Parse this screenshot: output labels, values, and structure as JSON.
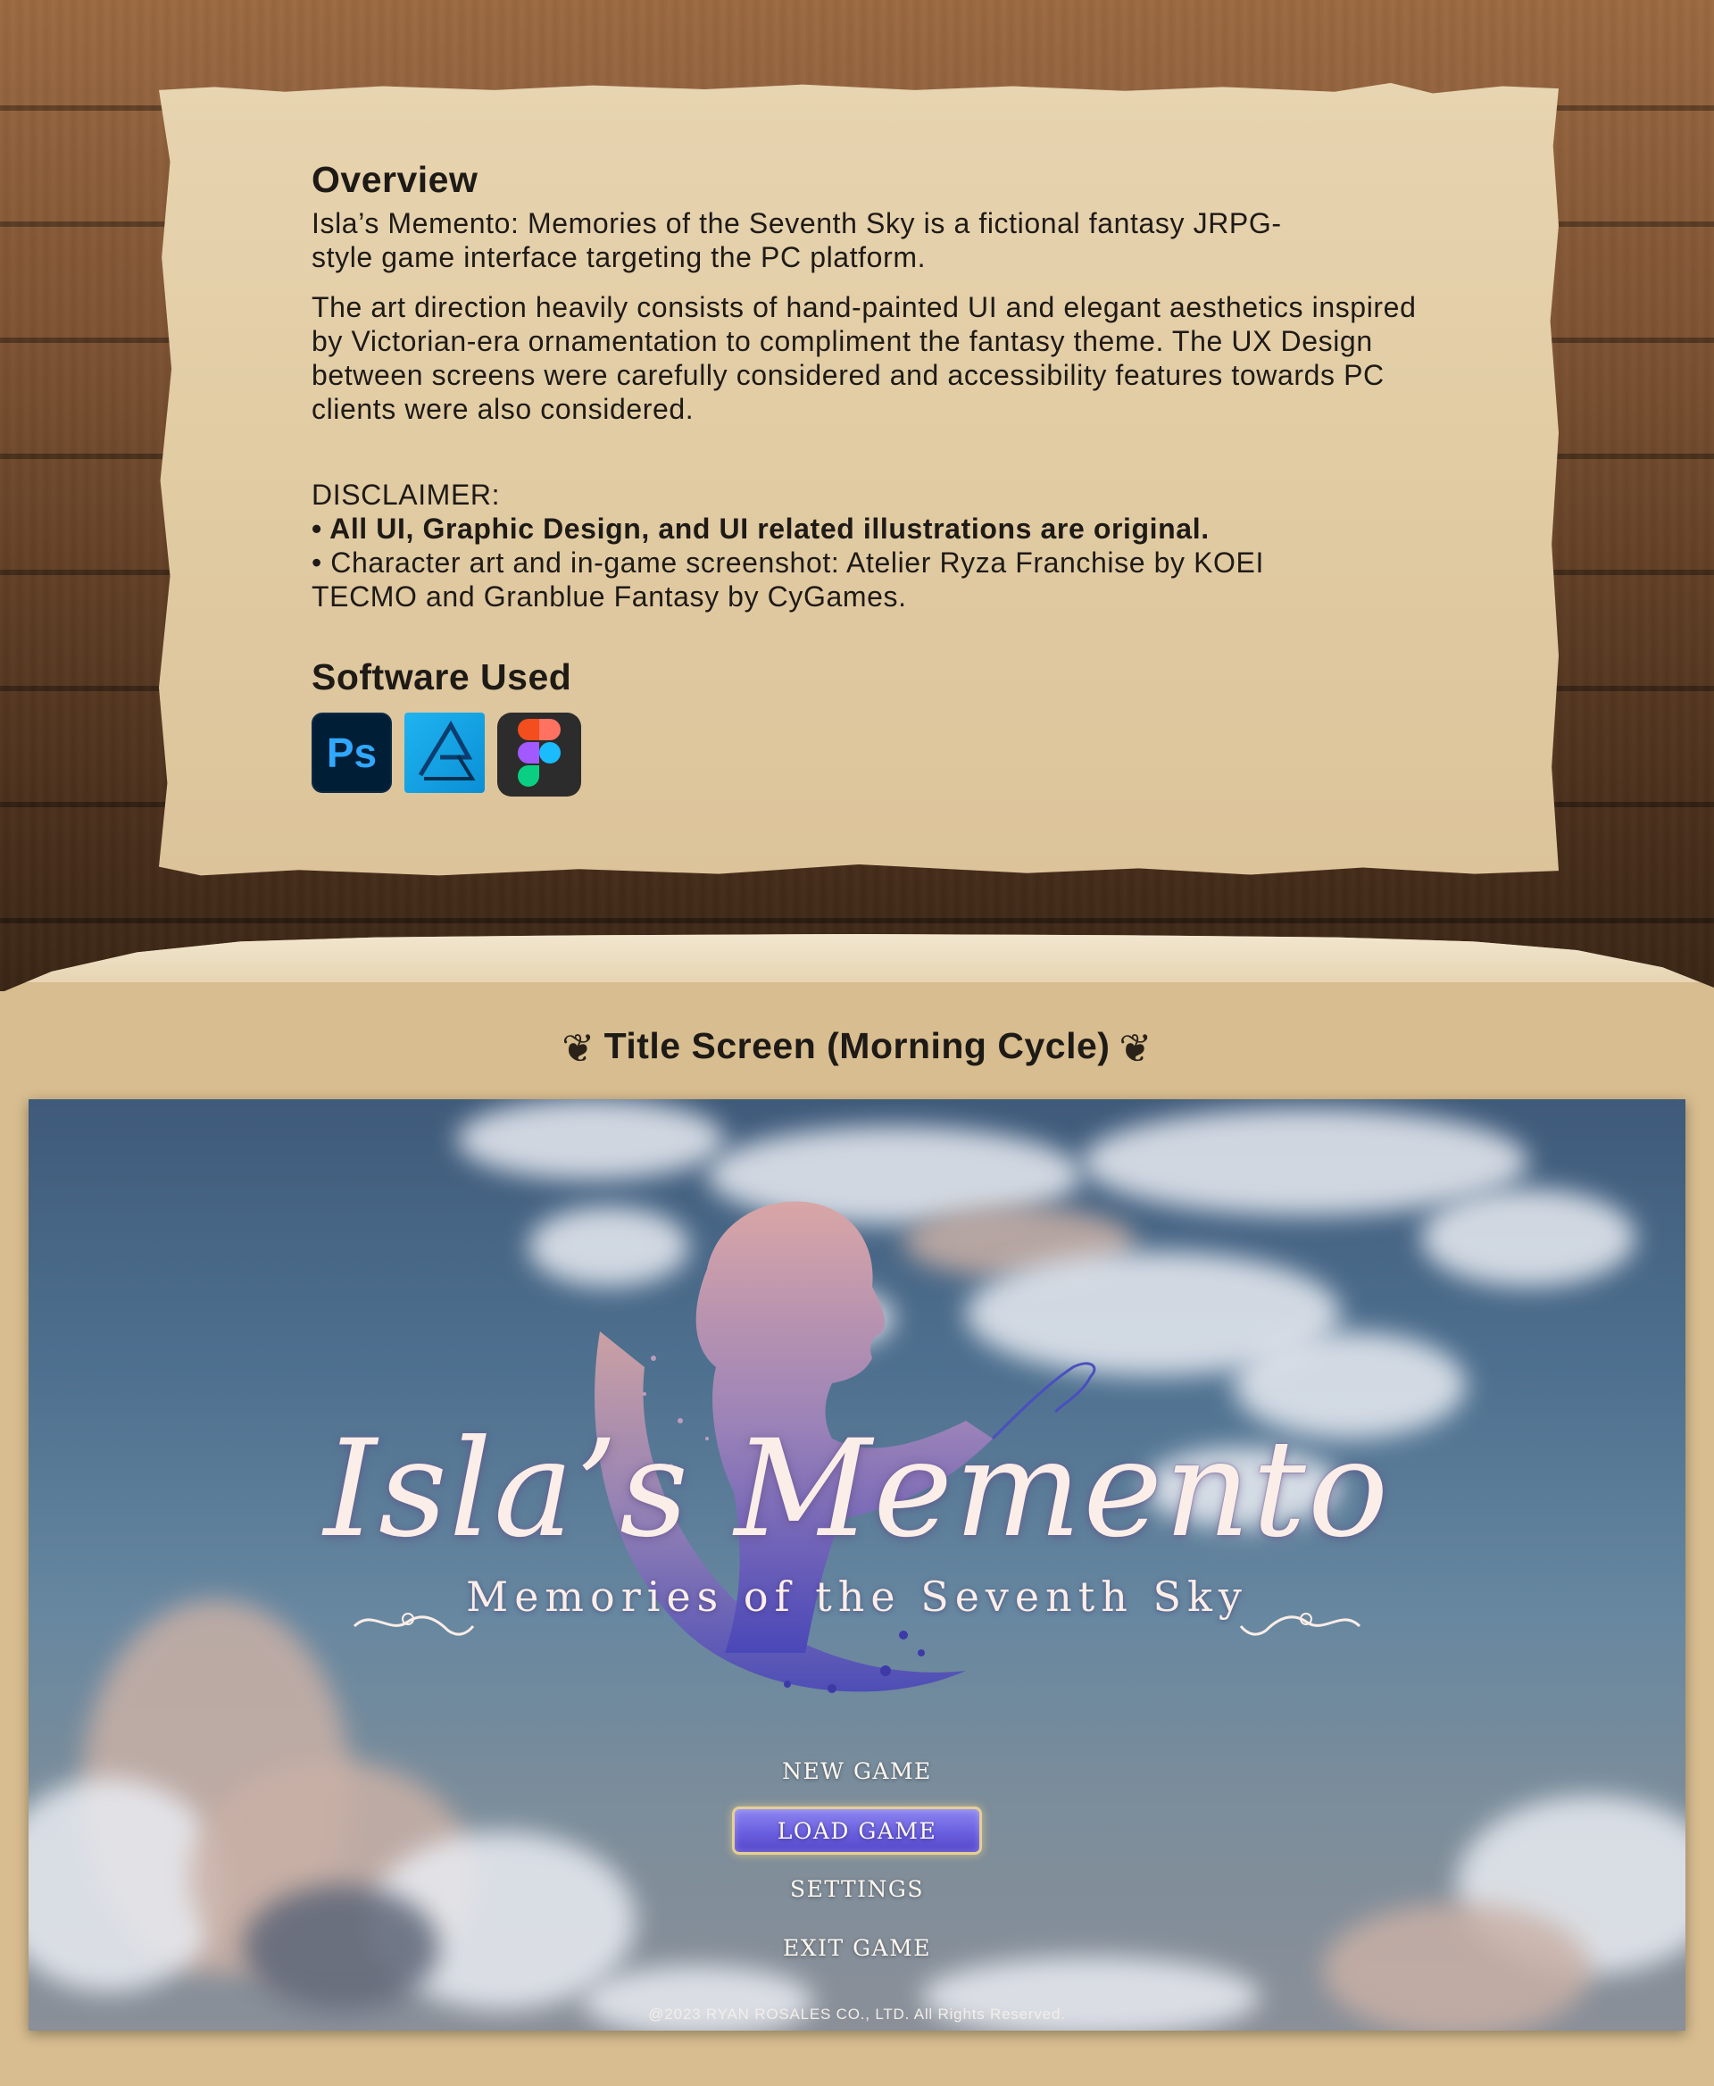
{
  "overview": {
    "heading": "Overview",
    "para1": "Isla’s Memento: Memories of the Seventh Sky is a fictional fantasy JRPG-style game interface targeting the PC platform.",
    "para2": "The art direction heavily consists of hand-painted UI and elegant aesthetics inspired by Victorian-era ornamentation to compliment the fantasy theme. The UX Design between screens were carefully considered and accessibility features towards PC clients were also considered.",
    "disclaimer_title": "DISCLAIMER:",
    "bullet1": "• All UI, Graphic Design, and UI related illustrations are original.",
    "bullet2": "• Character art and in-game screenshot: Atelier Ryza Franchise by KOEI TECMO and Granblue Fantasy by CyGames."
  },
  "software": {
    "heading": "Software Used",
    "icons": [
      "photoshop-icon",
      "affinity-designer-icon",
      "figma-icon"
    ],
    "ps_label": "Ps"
  },
  "section": {
    "title": "Title Screen (Morning Cycle)"
  },
  "game": {
    "logo_title": "Isla’s Memento",
    "logo_subtitle": "Memories of the Seventh Sky",
    "menu": [
      "NEW GAME",
      "LOAD GAME",
      "SETTINGS",
      "EXIT GAME"
    ],
    "selected_item": "LOAD GAME",
    "copyright": "@2023 RYAN ROSALES CO., LTD. All Rights Reserved."
  },
  "colors": {
    "accent_button": "#6a5fe0",
    "button_border": "#e6cf94",
    "parchment": "#e2cda5",
    "wood": "#7d5232"
  }
}
